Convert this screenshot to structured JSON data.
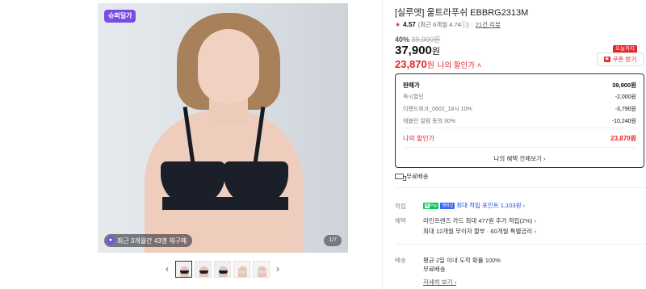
{
  "gallery": {
    "badge": "슈퍼딜가",
    "rebuy_text": "최근 3개월간 43명 재구매",
    "counter": "1/7",
    "prev": "‹",
    "next": "›",
    "thumbnail_count": 5
  },
  "product": {
    "title": "[실루엣] 울트라푸쉬 EBBRG2313M",
    "rating_score": "4.57",
    "rating_recent": "(최근 6개월 4.74ⓘ)",
    "reviews": "21건 리뷰",
    "discount_rate": "40%",
    "original_price": "39,900원",
    "price": "37,900",
    "price_unit": "원",
    "my_price": "23,870",
    "my_price_unit": "원",
    "my_price_label": "나의 할인가 ˄",
    "coupon_tag": "오늘까지",
    "coupon_btn": "쿠폰 받기"
  },
  "price_box": {
    "sale_label": "판매가",
    "sale_value": "39,900원",
    "rows": [
      {
        "label": "즉시할인",
        "value": "-2,000원"
      },
      {
        "label": "이랜드위크_0602_18시 10%",
        "value": "-3,790원"
      },
      {
        "label": "에블린 얼럼 동의 30%",
        "value": "-10,240원"
      }
    ],
    "mine_label": "나의 할인가",
    "mine_value": "23,870원",
    "all_benefits": "나의 혜택 전체보기 ›"
  },
  "free_shipping": "무료배송",
  "accrual": {
    "label": "적립",
    "npay": "N",
    "npay_text": "Pay",
    "plus": "멤버십",
    "text": "최대 적립 포인트 1,103원 ›"
  },
  "benefit": {
    "label": "혜택",
    "line1": "라인프렌즈 카드 최대 477원 추가 적립(2%) ›",
    "line2": "최대 12개월 무이자 할부 · 60개월 특별금리 ›"
  },
  "delivery": {
    "label": "배송",
    "line1": "평균 2일 이내 도착 확률 100%",
    "line2": "무료배송",
    "more": "자세히 보기 ›"
  },
  "colors": {
    "accent_red": "#e5242b",
    "badge_purple": "#7a4ce6",
    "npay_green": "#03c75a"
  }
}
